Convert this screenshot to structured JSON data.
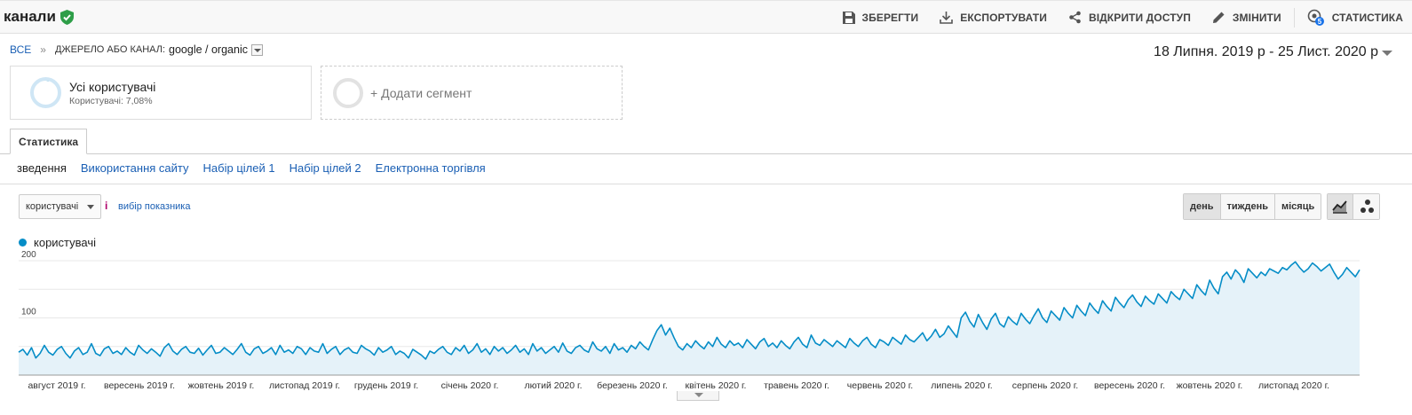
{
  "header": {
    "title": "канали",
    "actions": {
      "save": "ЗБЕРЕГТИ",
      "export": "ЕКСПОРТУВАТИ",
      "share": "ВІДКРИТИ ДОСТУП",
      "edit": "ЗМІНИТИ",
      "insights": "СТАТИСТИКА",
      "insights_badge": "5"
    }
  },
  "breadcrumb": {
    "all": "ВСЕ",
    "separator": "»",
    "dimension_label": "ДЖЕРЕЛО АБО КАНАЛ:",
    "dimension_value": "google / organic"
  },
  "date_range": {
    "text": "18 Липня. 2019 р  -  25 Лист. 2020 р"
  },
  "segments": {
    "active": {
      "name": "Усі користувачі",
      "sub": "Користувачі: 7,08%"
    },
    "add": "+ Додати сегмент"
  },
  "tabs": {
    "active": "Статистика"
  },
  "subnav": [
    "зведення",
    "Використання сайту",
    "Набір цілей 1",
    "Набір цілей 2",
    "Електронна торгівля"
  ],
  "metric_picker": {
    "selected": "користувачі",
    "info": "і",
    "link": "вибір показника"
  },
  "granularity": [
    "день",
    "тиждень",
    "місяць"
  ],
  "legend_label": "користувачі",
  "colors": {
    "line": "#058dc7",
    "fill": "#e5f2f9",
    "accent_link": "#1a5fb4",
    "shield": "#2e9e48"
  },
  "icons": {
    "verified": "shield-check-icon",
    "save": "floppy-icon",
    "export": "download-icon",
    "share": "share-icon",
    "edit": "pencil-icon",
    "insights": "insights-icon",
    "line_chart": "line-chart-icon",
    "motion_chart": "bubbles-icon"
  },
  "chart_data": {
    "type": "area",
    "ylim": [
      0,
      200
    ],
    "y_ticks": [
      100,
      200
    ],
    "grid": true,
    "x_tick_labels": [
      "август 2019 г.",
      "вересень 2019 г.",
      "жовтень 2019 г.",
      "листопад 2019 г.",
      "грудень 2019 г.",
      "січень 2020 г.",
      "лютий 2020 г.",
      "березень 2020 г.",
      "квітень 2020 г.",
      "травень 2020 г.",
      "червень 2020 г.",
      "липень 2020 г.",
      "серпень 2020 г.",
      "вересень 2020 г.",
      "жовтень 2020 г.",
      "листопад 2020 г."
    ],
    "series": [
      {
        "name": "користувачі",
        "values": [
          40,
          45,
          35,
          48,
          30,
          38,
          52,
          40,
          35,
          45,
          50,
          38,
          30,
          42,
          48,
          36,
          40,
          55,
          38,
          34,
          46,
          50,
          38,
          42,
          36,
          48,
          40,
          35,
          52,
          44,
          38,
          46,
          40,
          33,
          48,
          55,
          42,
          36,
          45,
          50,
          40,
          38,
          47,
          35,
          44,
          52,
          38,
          40,
          48,
          42,
          36,
          45,
          55,
          40,
          35,
          46,
          50,
          38,
          42,
          48,
          36,
          52,
          40,
          44,
          38,
          50,
          46,
          36,
          48,
          42,
          40,
          55,
          38,
          45,
          50,
          36,
          44,
          48,
          40,
          38,
          52,
          46,
          42,
          35,
          48,
          40,
          44,
          50,
          36,
          42,
          38,
          30,
          45,
          40,
          35,
          28,
          42,
          38,
          45,
          50,
          40,
          36,
          48,
          42,
          52,
          38,
          44,
          55,
          40,
          46,
          36,
          50,
          42,
          48,
          38,
          44,
          52,
          40,
          46,
          36,
          55,
          42,
          48,
          38,
          44,
          50,
          40,
          56,
          42,
          38,
          48,
          52,
          44,
          40,
          58,
          46,
          42,
          50,
          38,
          55,
          44,
          48,
          40,
          52,
          46,
          58,
          50,
          44,
          62,
          78,
          88,
          70,
          82,
          65,
          50,
          44,
          55,
          48,
          60,
          52,
          46,
          58,
          50,
          66,
          54,
          48,
          60,
          52,
          56,
          48,
          62,
          54,
          46,
          58,
          64,
          50,
          56,
          48,
          60,
          52,
          46,
          58,
          66,
          54,
          48,
          70,
          56,
          52,
          62,
          56,
          50,
          60,
          54,
          48,
          64,
          56,
          50,
          60,
          66,
          54,
          48,
          62,
          58,
          52,
          66,
          60,
          54,
          70,
          62,
          58,
          66,
          74,
          60,
          68,
          80,
          66,
          72,
          86,
          76,
          66,
          100,
          110,
          94,
          84,
          106,
          92,
          80,
          98,
          108,
          90,
          84,
          102,
          94,
          88,
          108,
          98,
          90,
          104,
          116,
          100,
          92,
          112,
          104,
          96,
          118,
          108,
          100,
          122,
          112,
          104,
          126,
          116,
          108,
          130,
          120,
          112,
          136,
          126,
          118,
          132,
          140,
          128,
          120,
          138,
          130,
          124,
          142,
          134,
          126,
          146,
          138,
          132,
          150,
          142,
          134,
          158,
          148,
          140,
          166,
          152,
          142,
          172,
          180,
          168,
          184,
          176,
          162,
          186,
          178,
          170,
          180,
          174,
          186,
          182,
          178,
          188,
          184,
          192,
          198,
          188,
          180,
          186,
          196,
          190,
          182,
          188,
          194,
          180,
          168,
          176,
          188,
          180,
          172,
          184
        ]
      }
    ]
  }
}
